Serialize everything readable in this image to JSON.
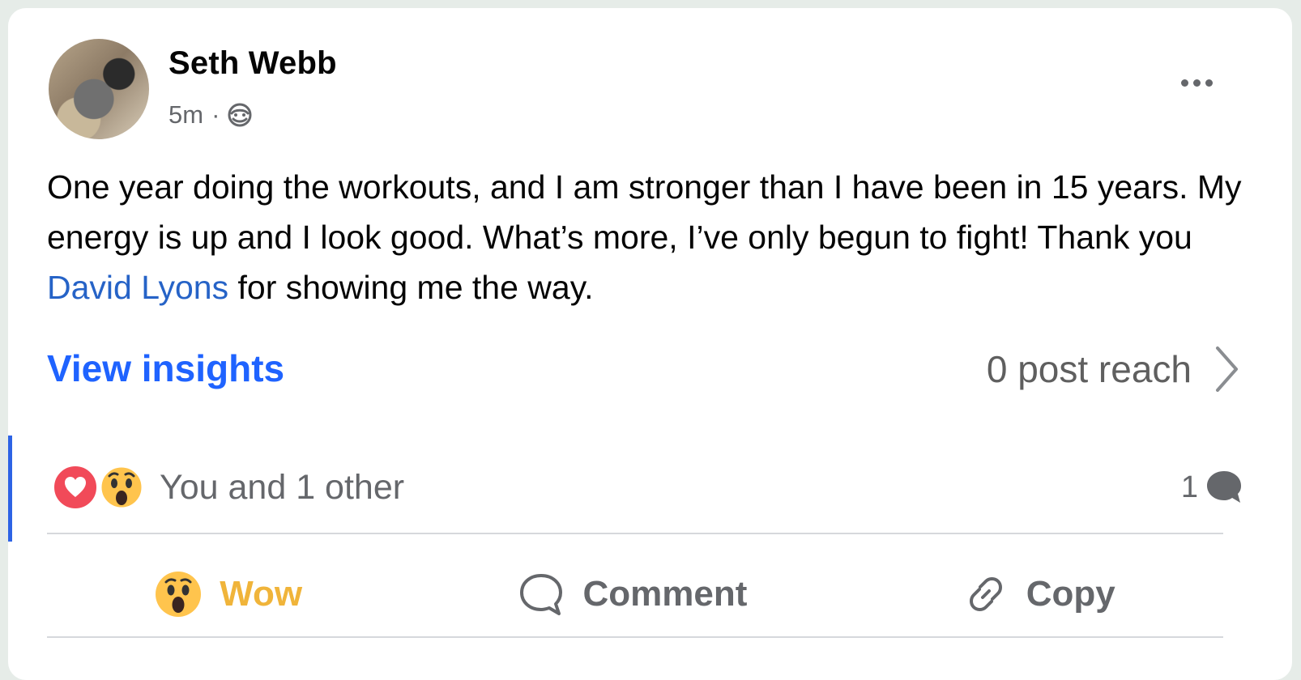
{
  "post": {
    "author": "Seth Webb",
    "time": "5m",
    "separator": "·",
    "audience_icon": "globe-icon",
    "more_icon": "more-options-icon",
    "text": {
      "before_mention": "One year doing the workouts, and I am stronger than I have been in 15 years. My energy is up and I look good. What’s more, I’ve only begun to fight! Thank you ",
      "mention": "David Lyons",
      "after_mention": " for showing me the way."
    }
  },
  "insights": {
    "view_label": "View insights",
    "reach_text": "0 post reach"
  },
  "reactions": {
    "icons": [
      "love-icon",
      "wow-icon"
    ],
    "summary": "You and 1 other",
    "comment_count": "1"
  },
  "actions": {
    "wow": "Wow",
    "comment": "Comment",
    "copy": "Copy"
  },
  "colors": {
    "link_blue": "#1f63ff",
    "mention_blue": "#2663c7",
    "wow_yellow": "#f0b43a",
    "love_red": "#f14a59",
    "secondary_gray": "#65676b"
  }
}
